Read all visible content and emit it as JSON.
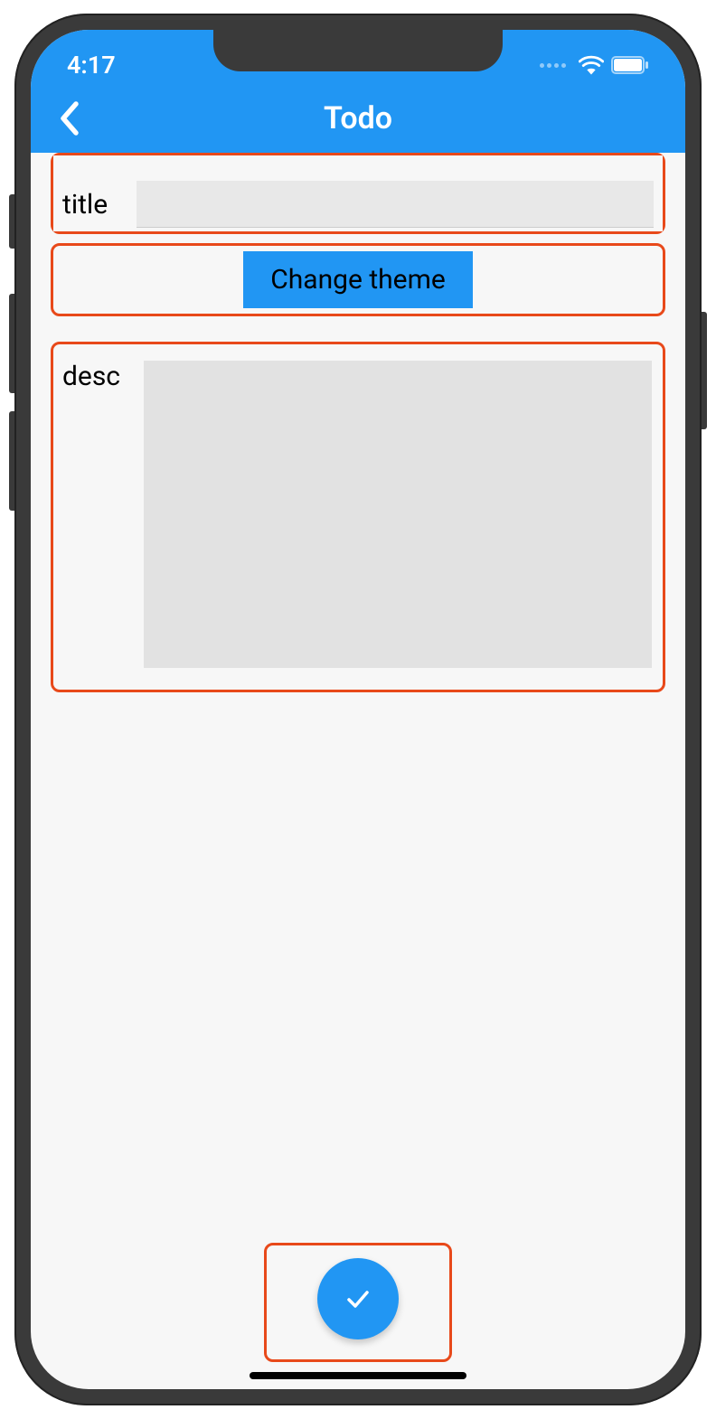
{
  "status": {
    "time": "4:17"
  },
  "nav": {
    "title": "Todo"
  },
  "form": {
    "title_label": "title",
    "title_value": "",
    "theme_button_label": "Change theme",
    "desc_label": "desc",
    "desc_value": ""
  },
  "colors": {
    "primary": "#2196f3",
    "highlight": "#e8491a"
  }
}
